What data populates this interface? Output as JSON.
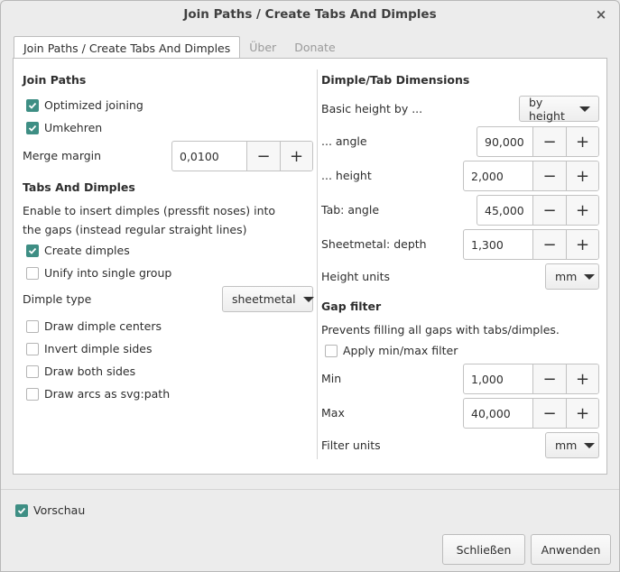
{
  "window": {
    "title": "Join Paths / Create Tabs And Dimples",
    "close_glyph": "×"
  },
  "tabs": [
    {
      "label": "Join Paths / Create Tabs And Dimples",
      "active": true
    },
    {
      "label": "Über",
      "active": false
    },
    {
      "label": "Donate",
      "active": false
    }
  ],
  "left": {
    "join_paths": {
      "title": "Join Paths",
      "optimized_joining": {
        "label": "Optimized joining",
        "checked": true
      },
      "umkehren": {
        "label": "Umkehren",
        "checked": true
      },
      "merge_margin": {
        "label": "Merge margin",
        "value": "0,0100"
      }
    },
    "tabs_dimples": {
      "title": "Tabs And Dimples",
      "description_line1": "Enable to insert dimples (pressfit noses) into",
      "description_line2": "the gaps (instead regular straight lines)",
      "create_dimples": {
        "label": "Create dimples",
        "checked": true
      },
      "unify_group": {
        "label": "Unify into single group",
        "checked": false
      },
      "dimple_type": {
        "label": "Dimple type",
        "value": "sheetmetal"
      },
      "draw_centers": {
        "label": "Draw dimple centers",
        "checked": false
      },
      "invert_sides": {
        "label": "Invert dimple sides",
        "checked": false
      },
      "draw_both": {
        "label": "Draw both sides",
        "checked": false
      },
      "draw_arcs": {
        "label": "Draw arcs as svg:path",
        "checked": false
      }
    }
  },
  "right": {
    "dimensions": {
      "title": "Dimple/Tab Dimensions",
      "basic_height": {
        "label": "Basic height by ...",
        "value": "by height"
      },
      "angle": {
        "label": "... angle",
        "value": "90,000"
      },
      "height": {
        "label": "... height",
        "value": "2,000"
      },
      "tab_angle": {
        "label": "Tab: angle",
        "value": "45,000"
      },
      "sheetmetal_depth": {
        "label": "Sheetmetal: depth",
        "value": "1,300"
      },
      "height_units": {
        "label": "Height units",
        "value": "mm"
      }
    },
    "gap_filter": {
      "title": "Gap filter",
      "description": "Prevents filling all gaps with tabs/dimples.",
      "apply_filter": {
        "label": "Apply min/max filter",
        "checked": false
      },
      "min": {
        "label": "Min",
        "value": "1,000"
      },
      "max": {
        "label": "Max",
        "value": "40,000"
      },
      "filter_units": {
        "label": "Filter units",
        "value": "mm"
      }
    }
  },
  "spin_symbols": {
    "minus": "−",
    "plus": "+"
  },
  "footer": {
    "vorschau": {
      "label": "Vorschau",
      "checked": true
    },
    "close_label": "Schließen",
    "apply_label": "Anwenden"
  },
  "colors": {
    "accent": "#3e8e84"
  }
}
